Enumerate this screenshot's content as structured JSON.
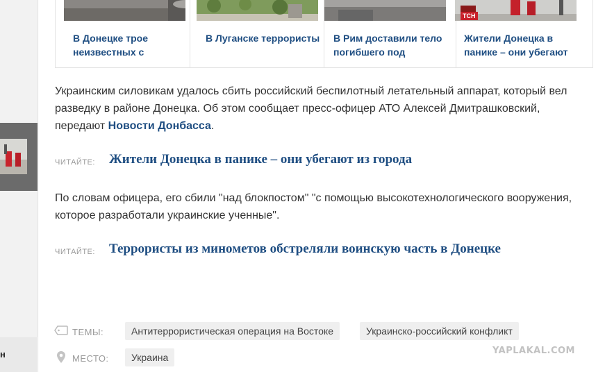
{
  "related": [
    {
      "title": "В Донецке трое неизвестных с"
    },
    {
      "title": "В Луганске террористы"
    },
    {
      "title": "В Рим доставили тело погибшего под"
    },
    {
      "title": "Жители Донецка в панике – они убегают",
      "badge": "ТСН"
    }
  ],
  "article": {
    "p1_text": "Украинским силовикам удалось сбить российский беспилотный летательный аппарат, который вел разведку в районе Донецка. Об этом сообщает пресс-офицер АТО Алексей Дмитрашковский, передают ",
    "p1_link": "Новости Донбасса",
    "p1_end": ".",
    "read_label": "ЧИТАЙТЕ:",
    "read1": "Жители Донецка в панике – они убегают из города",
    "p2": "По словам офицера, его сбили \"над блокпостом\" \"с помощью высокотехнологического вооружения, которое разработали украинские ученные\".",
    "read2": "Террористы из минометов обстреляли воинскую часть в Донецке"
  },
  "meta": {
    "themes_label": "ТЕМЫ:",
    "themes": [
      "Антитеррористическая операция на Востоке",
      "Украинско-российский конфликт"
    ],
    "place_label": "МЕСТО:",
    "places": [
      "Украина"
    ]
  },
  "left": {
    "bottom_char": "н"
  },
  "watermark": "YAPLAKAL.COM",
  "colors": {
    "link": "#1f4e82",
    "tag_bg": "#efefef",
    "label": "#999999"
  }
}
